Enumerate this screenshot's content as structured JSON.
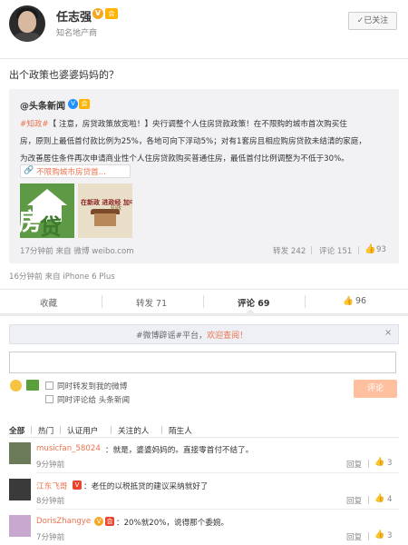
{
  "header": {
    "username": "任志强",
    "verified_mark": "V",
    "level_mark": "会",
    "subtitle": "知名地产商",
    "follow_label": "已关注"
  },
  "post": {
    "text": "出个政策也婆婆妈妈的？",
    "time_source": "16分钟前 来自 iPhone 6 Plus"
  },
  "repost": {
    "user": "@头条新闻",
    "verified_mark": "V",
    "body_tag": "#知政#",
    "body_line1_rest": "【  注意，房贷政策放宽啦！】央行调整个人住房贷款政策！在不限购的城市首次购买住",
    "body_line2": "房，原则上最低首付款比例为25%，各地可向下浮动5%；对有1套房且相应购房贷款未结清的家庭，",
    "body_line3": "为改善居住条件再次申请商业性个人住房贷款购买普通住房，最低首付比例调整为不低于30%。",
    "link_text": "不限购城市房贷首...",
    "image1_glyph": "房",
    "image1_glyph2": "贷",
    "image2_caption": "在新政 进政经 加中国",
    "image2_caption2": "知政",
    "time_source": "17分钟前 来自 微博 weibo.com",
    "repost_label": "转发 242",
    "comment_label": "评论 151",
    "like_count": "93"
  },
  "actions": {
    "favorite": "收藏",
    "repost": "转发 71",
    "comment": "评论 69",
    "like": "96"
  },
  "comments_section": {
    "notice_prefix": "#微博辟谣#平台，",
    "notice_highlight": "欢迎查阅！",
    "input_placeholder": "",
    "checkbox1_label": "同时转发到我的微博",
    "checkbox2_label": "同时评论给 头条新闻",
    "submit_label": "评论",
    "filters": [
      "全部",
      "热门",
      "认证用户",
      "关注的人",
      "陌生人"
    ]
  },
  "comments": [
    {
      "user": "musicfan_58024",
      "text": "：就是，婆婆妈妈的。直接零首付不结了。",
      "time": "9分钟前",
      "reply": "回复",
      "likes": "3"
    },
    {
      "user": "江东飞哥",
      "text": "：老任的以税抵贷的建议采纳就好了",
      "time": "8分钟前",
      "reply": "回复",
      "likes": "4"
    },
    {
      "user": "DorisZhangye",
      "text": "：20%就20%，说得那个委婉。",
      "time": "7分钟前",
      "reply": "回复",
      "likes": "3"
    }
  ],
  "colors": {
    "accent": "#eb7350",
    "link": "#eb7350",
    "repost_bg": "#f2f2f5",
    "submit_bg": "#ffc09f"
  }
}
